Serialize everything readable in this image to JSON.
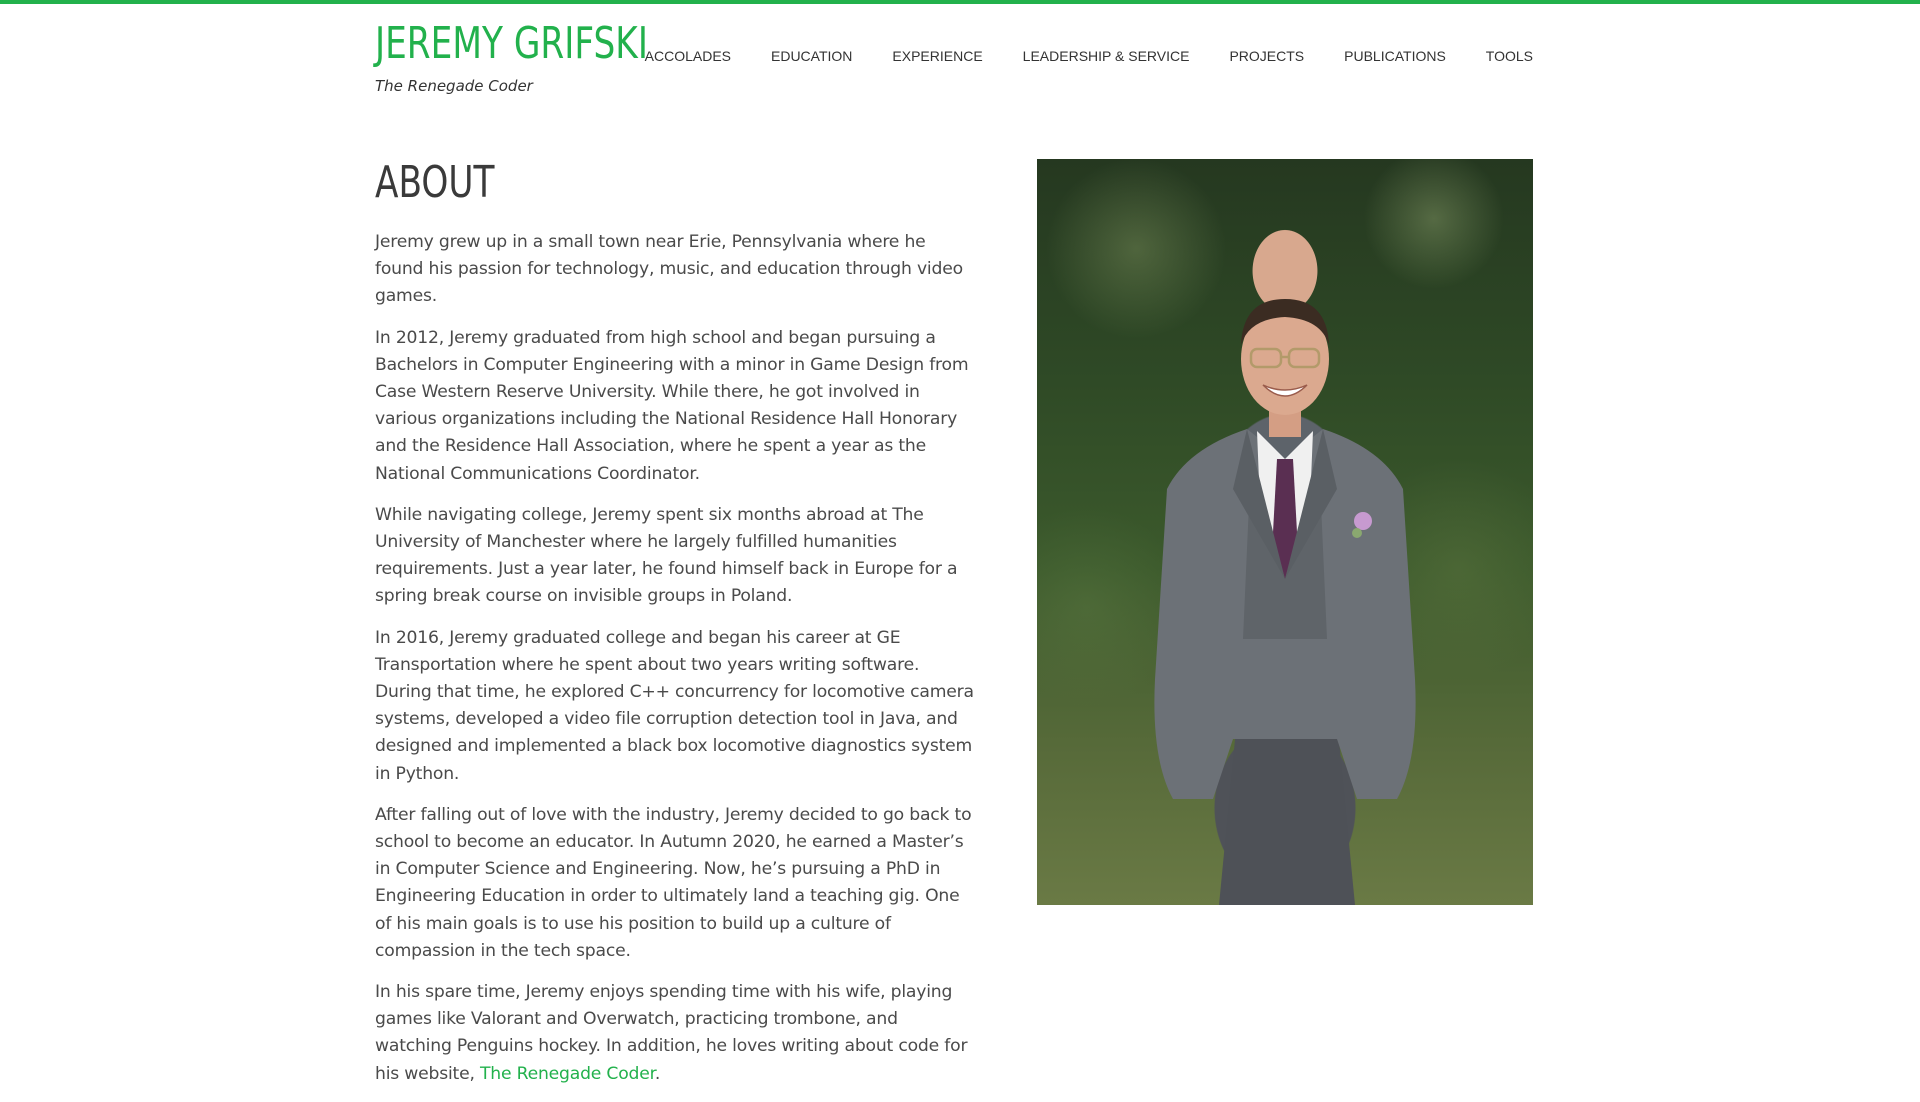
{
  "colors": {
    "accent": "#22b14c",
    "text": "#4a4a4a",
    "heading": "#3a3a3a"
  },
  "header": {
    "title": "JEREMY GRIFSKI",
    "tagline": "The Renegade Coder"
  },
  "nav": {
    "items": [
      {
        "label": "ACCOLADES"
      },
      {
        "label": "EDUCATION"
      },
      {
        "label": "EXPERIENCE"
      },
      {
        "label": "LEADERSHIP & SERVICE"
      },
      {
        "label": "PROJECTS"
      },
      {
        "label": "PUBLICATIONS"
      },
      {
        "label": "TOOLS"
      }
    ]
  },
  "about": {
    "heading": "ABOUT",
    "paragraphs": [
      "Jeremy grew up in a small town near Erie, Pennsylvania where he found his passion for technology, music, and education through video games.",
      "In 2012, Jeremy graduated from high school and began pursuing a Bachelors in Computer Engineering with a minor in Game Design from Case Western Reserve University. While there, he got involved in various organizations including the National Residence Hall Honorary and the Residence Hall Association, where he spent a year as the National Communications Coordinator.",
      "While navigating college, Jeremy spent six months abroad at The University of Manchester where he largely fulfilled humanities requirements. Just a year later, he found himself back in Europe for a spring break course on invisible groups in Poland.",
      "In 2016, Jeremy graduated college and began his career at GE Transportation where he spent about two years writing software. During that time, he explored C++ concurrency for locomotive camera systems, developed a video file corruption detection tool in Java, and designed and implemented a black box locomotive diagnostics system in Python.",
      "After falling out of love with the industry, Jeremy decided to go back to school to become an educator. In Autumn 2020, he earned a Master’s in Computer Science and Engineering. Now, he’s pursuing a PhD in Engineering Education in order to ultimately land a teaching gig. One of his main goals is to use his position to build up a culture of compassion in the tech space."
    ],
    "last_paragraph_prefix": "In his spare time, Jeremy enjoys spending time with his wife, playing games like Valorant and Overwatch, practicing trombone, and watching Penguins hockey. In addition, he loves writing about code for his website, ",
    "last_paragraph_link": "The Renegade Coder",
    "last_paragraph_suffix": "."
  },
  "photo": {
    "icon": "portrait-photo"
  }
}
